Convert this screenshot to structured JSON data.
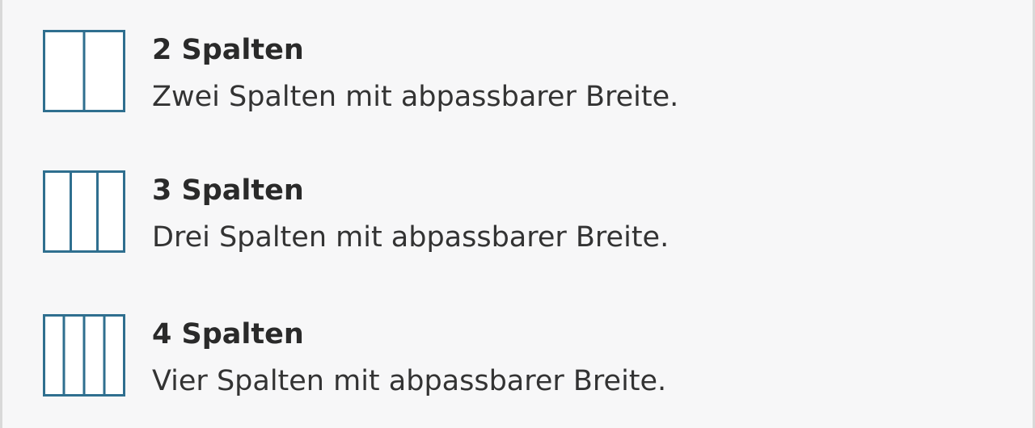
{
  "colors": {
    "icon_stroke": "#2f6f8f",
    "icon_fill": "#ffffff",
    "background": "#f7f7f8",
    "title_text": "#2a2a2a",
    "description_text": "#333333"
  },
  "options": [
    {
      "title": "2 Spalten",
      "description": "Zwei Spalten mit abpassbarer Breite.",
      "icon": "two-columns-icon"
    },
    {
      "title": "3 Spalten",
      "description": "Drei Spalten mit abpassbarer Breite.",
      "icon": "three-columns-icon"
    },
    {
      "title": "4 Spalten",
      "description": "Vier Spalten mit abpassbarer Breite.",
      "icon": "four-columns-icon"
    }
  ]
}
